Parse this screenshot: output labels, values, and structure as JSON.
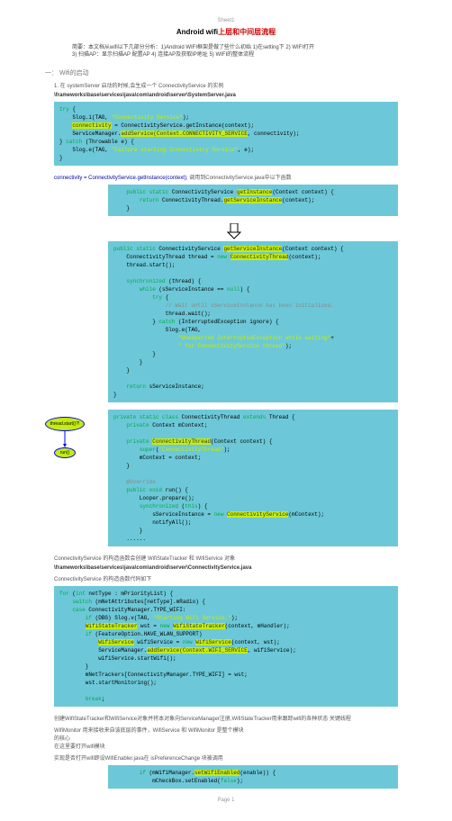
{
  "sheet": "Sheet1",
  "title_prefix": "Android wifi",
  "title_red": "上层和中间层流程",
  "intro": "简要：本文档从wifi以下几部分分析：1)Android WIFI框架是做了些什么初始  1)在setting下  2) WIFI打开\n          3) 扫描AP：显示扫描AP   配置AP  4)  连接AP及获取IP地址   5) WIFI的整体流程",
  "sec1": "一：    Wifi的启动",
  "sub1": "1. 在 systemServer 启动的时候,会生成一个 ConnectivityService 的实例",
  "path1": "\\frameworks\\base\\services\\java\\com\\android\\server\\SystemServer.java",
  "code1": "try {\n    Slog.i(TAG, \"Connectivity Service\");\n    connectivity = ConnectivityService.getInstance(context);\n    ServiceManager.addService(Context.CONNECTIVITY_SERVICE, connectivity);\n} catch (Throwable e) {\n    Slog.e(TAG, \"Failure starting Connectivity Service\", e);\n}",
  "note1_a": "connectivity = ConnectivityService.getInstance(context);",
  "note1_b": "调用到ConnectivityService.java中以下函数",
  "code2": "    public static ConnectivityService getInstance(Context context) {\n        return ConnectivityThread.getServiceInstance(context);\n    }",
  "code3": "public static ConnectivityService getServiceInstance(Context context) {\n    ConnectivityThread thread = new ConnectivityThread(context);\n    thread.start();\n\n    synchronized (thread) {\n        while (sServiceInstance == null) {\n            try {\n                // Wait until sServiceInstance has been initialized.\n                thread.wait();\n            } catch (InterruptedException ignore) {\n                Slog.e(TAG,\n                    \"Unexpected InterruptedException while waiting\"+\n                    \" for ConnectivityService thread\");\n            }\n        }\n    }\n\n    return sServiceInstance;\n}",
  "flow_label1": "thread.start()?!",
  "flow_label2": "run()",
  "code4": "private static class ConnectivityThread extends Thread {\n    private Context mContext;\n\n    private ConnectivityThread(Context context) {\n        super(\"ConnectivityThread\");\n        mContext = context;\n    }\n\n    @Override\n    public void run() {\n        Looper.prepare();\n        synchronized (this) {\n            sServiceInstance = new ConnectivityService(mContext);\n            notifyAll();\n        }\n    ......",
  "note2": "ConnectivityService  的构造函数会创建      WifiStateTracker      和               WifiService                对象",
  "path2": "\\frameworks\\base\\services\\java\\com\\android\\server\\ConnectivityService.java",
  "note3": "ConnectivityService    的构造函数代码如下",
  "code5": "for (int netType : mPriorityList) {\n    switch (mNetAttributes[netType].mRadio) {\n    case ConnectivityManager.TYPE_WIFI:\n        if (DBG) Slog.v(TAG, \"Starting Wifi Service.\");\n        WifiStateTracker wst = new WifiStateTracker(context, mHandler);\n        if (FeatureOption.HAVE_WLAN_SUPPORT)\n            WifiService wifiService = new WifiService(context, wst);\n            ServiceManager.addService(Context.WIFI_SERVICE, wifiService);\n            wifiService.startWifi();\n        }\n        mNetTrackers[ConnectivityManager.TYPE_WIFI] = wst;\n        wst.startMonitoring();\n\n        break;",
  "note4": "创建WifiStateTracker和WifiService对象并将本对象向ServiceManager注册,WifiStateTracker用来跟踪wifi的各种状态  关键线程",
  "note5": "WifiMonitor 用来接收来自该底层的事件，WifiService 和 WifiMonitor 是整个模块\n的核心\n在这里要打开wifi模块",
  "note6": "实现是否打开wifi即设WifiEnabler.java在               isPreferenceChange 块被调用",
  "code6": "        if (mWifiManager.setWifiEnabled(enable)) {\n            mCheckBox.setEnabled(false);",
  "pagenum": "Page 1"
}
